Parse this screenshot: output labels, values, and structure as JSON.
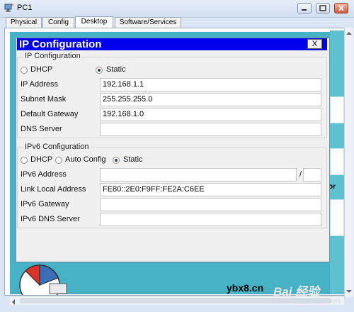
{
  "window": {
    "title": "PC1",
    "tabs": [
      "Physical",
      "Config",
      "Desktop",
      "Software/Services"
    ],
    "active_tab": "Desktop"
  },
  "dialog": {
    "title": "IP Configuration",
    "close_label": "X",
    "ipv4": {
      "section_title": "IP Configuration",
      "dhcp_label": "DHCP",
      "static_label": "Static",
      "selected": "Static",
      "ip_address_label": "IP Address",
      "ip_address_value": "192.168.1.1",
      "subnet_mask_label": "Subnet Mask",
      "subnet_mask_value": "255.255.255.0",
      "default_gateway_label": "Default Gateway",
      "default_gateway_value": "192.168.1.0",
      "dns_server_label": "DNS Server",
      "dns_server_value": ""
    },
    "ipv6": {
      "section_title": "IPv6 Configuration",
      "dhcp_label": "DHCP",
      "auto_config_label": "Auto Config",
      "static_label": "Static",
      "selected": "Static",
      "ipv6_address_label": "IPv6 Address",
      "ipv6_address_value": "",
      "prefix_separator": "/",
      "prefix_value": "",
      "link_local_label": "Link Local Address",
      "link_local_value": "FE80::2E0:F9FF:FE2A:C6EE",
      "ipv6_gateway_label": "IPv6 Gateway",
      "ipv6_gateway_value": "",
      "ipv6_dns_label": "IPv6 DNS Server",
      "ipv6_dns_value": ""
    }
  },
  "background_peek": {
    "right_edge_text": "or"
  },
  "watermark": {
    "site": "ybx8.cn",
    "brand": "Bai 经验",
    "sub": "jingyan.baidu.com"
  },
  "colors": {
    "dialog_title_bg": "#0000ee",
    "desktop_bg": "#47b2c5"
  }
}
